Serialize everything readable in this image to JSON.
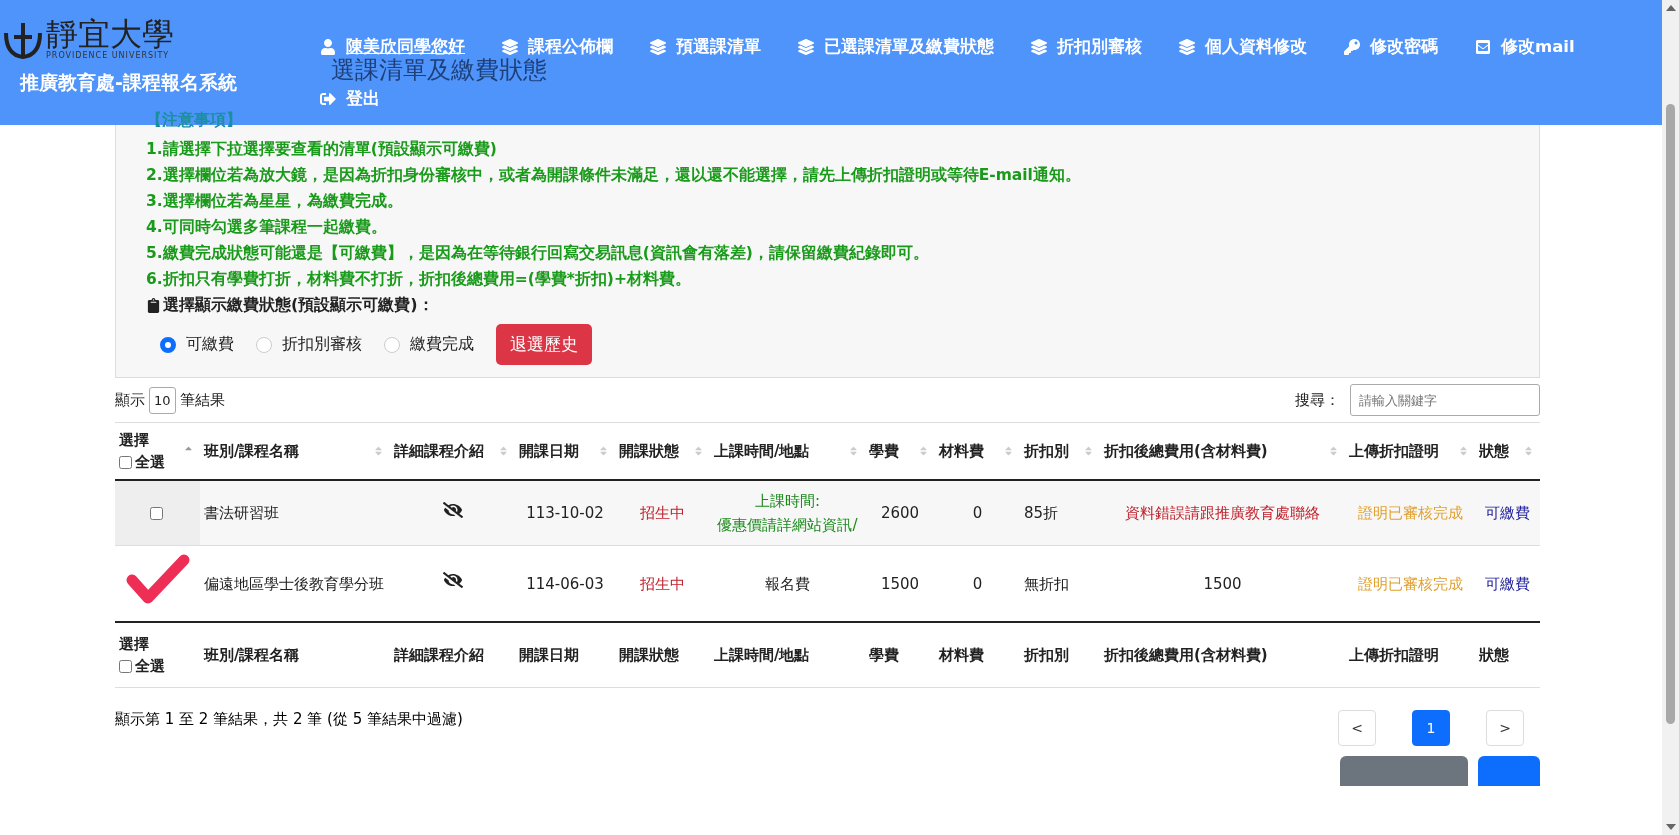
{
  "header": {
    "logo_text": "靜宜大學",
    "logo_subtext": "PROVIDENCE UNIVERSITY",
    "system_title": "推廣教育處-課程報名系統",
    "nav": [
      {
        "label": "陳美欣同學您好",
        "kind": "user",
        "link": true
      },
      {
        "label": "課程公佈欄",
        "kind": "layers",
        "link": false
      },
      {
        "label": "預選課清單",
        "kind": "layers",
        "link": false
      },
      {
        "label": "已選課清單及繳費狀態",
        "kind": "layers",
        "link": false
      },
      {
        "label": "折扣別審核",
        "kind": "layers",
        "link": false
      },
      {
        "label": "個人資料修改",
        "kind": "layers",
        "link": false
      },
      {
        "label": "修改密碼",
        "kind": "key",
        "link": false
      },
      {
        "label": "修改mail",
        "kind": "mail",
        "link": false
      },
      {
        "label": "登出",
        "kind": "logout",
        "link": false
      }
    ]
  },
  "page_title": "選課清單及繳費狀態",
  "notice": {
    "heading": "【注意事項】",
    "items": [
      "1.請選擇下拉選擇要查看的清單(預設顯示可繳費)",
      "2.選擇欄位若為放大鏡，是因為折扣身份審核中，或者為開課條件未滿足，還以還不能選擇，請先上傳折扣證明或等待E-mail通知。",
      "3.選擇欄位若為星星，為繳費完成。",
      "4.可同時勾選多筆課程一起繳費。",
      "5.繳費完成狀態可能還是【可繳費】，是因為在等待銀行回寫交易訊息(資訊會有落差)，請保留繳費紀錄即可。",
      "6.折扣只有學費打折，材料費不打折，折扣後總費用=(學費*折扣)+材料費。"
    ]
  },
  "filter": {
    "label": "選擇顯示繳費狀態(預設顯示可繳費)：",
    "options": [
      {
        "label": "可繳費",
        "selected": true
      },
      {
        "label": "折扣別審核",
        "selected": false
      },
      {
        "label": "繳費完成",
        "selected": false
      }
    ],
    "history_button": "退選歷史"
  },
  "length_control": {
    "prefix": "顯示",
    "value": "10",
    "suffix": "筆結果"
  },
  "search": {
    "label": "搜尋：",
    "placeholder": "請輸入關鍵字"
  },
  "table": {
    "columns": [
      "選擇",
      "班別/課程名稱",
      "詳細課程介紹",
      "開課日期",
      "開課狀態",
      "上課時間/地點",
      "學費",
      "材料費",
      "折扣別",
      "折扣後總費用(含材料費)",
      "上傳折扣證明",
      "狀態"
    ],
    "select_all": {
      "label": "全選",
      "checked": false
    },
    "rows": [
      {
        "kind": "checkbox",
        "checked": false,
        "name": "書法研習班",
        "date": "113-10-02",
        "status": "招生中",
        "time_place": {
          "kind": "schedule",
          "text": "上課時間:\n優惠價請詳網站資訊/"
        },
        "tuition": "2600",
        "material": "0",
        "discount": "85折",
        "total": {
          "kind": "error",
          "text": "資料錯誤請跟推廣教育處聯絡"
        },
        "proof": "證明已審核完成",
        "state": "可繳費"
      },
      {
        "kind": "check-mark",
        "checked": true,
        "name": "偏遠地區學士後教育學分班",
        "date": "114-06-03",
        "status": "招生中",
        "time_place": {
          "kind": "plain",
          "text": "報名費"
        },
        "tuition": "1500",
        "material": "0",
        "discount": "無折扣",
        "total": {
          "kind": "plain",
          "text": "1500"
        },
        "proof": "證明已審核完成",
        "state": "可繳費"
      }
    ],
    "footer_columns": [
      "選擇",
      "班別/課程名稱",
      "詳細課程介紹",
      "開課日期",
      "開課狀態",
      "上課時間/地點",
      "學費",
      "材料費",
      "折扣別",
      "折扣後總費用(含材料費)",
      "上傳折扣證明",
      "狀態"
    ],
    "footer_select_all": {
      "label": "全選",
      "checked": false
    }
  },
  "info": "顯示第 1 至 2 筆結果，共 2 筆 (從 5 筆結果中過濾)",
  "pagination": {
    "prev": "<",
    "pages": [
      {
        "label": "1",
        "selected": true
      }
    ],
    "next": ">"
  }
}
